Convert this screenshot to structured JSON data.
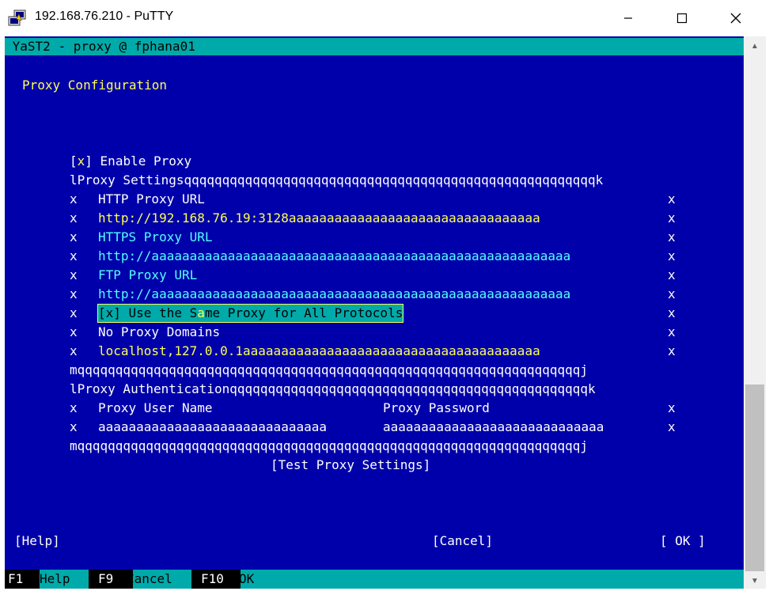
{
  "window": {
    "title": "192.168.76.210 - PuTTY",
    "icon": "putty-icon",
    "controls": [
      "minimize-icon",
      "maximize-icon",
      "close-icon"
    ]
  },
  "terminal": {
    "header": "YaST2 - proxy @ fphana01",
    "page_title": "Proxy Configuration",
    "enable_proxy": {
      "box": "[x]",
      "label": "Enable Proxy"
    },
    "frame_settings_top": "lProxy Settingsqqqqqqqqqqqqqqqqqqqqqqqqqqqqqqqqqqqqqqqqqqqqqqqqqqqqqqk",
    "http_label": "HTTP Proxy URL",
    "http_value": "http://192.168.76.19:3128aaaaaaaaaaaaaaaaaaaaaaaaaaaaaaaaa",
    "https_label": "HTTPS Proxy URL",
    "https_value": "http://aaaaaaaaaaaaaaaaaaaaaaaaaaaaaaaaaaaaaaaaaaaaaaaaaaaaaaa",
    "ftp_label": "FTP Proxy URL",
    "ftp_value": "http://aaaaaaaaaaaaaaaaaaaaaaaaaaaaaaaaaaaaaaaaaaaaaaaaaaaaaaa",
    "same_proxy": {
      "pre": "[x] Use the S",
      "cursor": "a",
      "post": "me Proxy for All Protocols"
    },
    "no_proxy_label": "No Proxy Domains",
    "no_proxy_value": "localhost,127.0.0.1aaaaaaaaaaaaaaaaaaaaaaaaaaaaaaaaaaaaaaa",
    "frame_settings_bottom": "mqqqqqqqqqqqqqqqqqqqqqqqqqqqqqqqqqqqqqqqqqqqqqqqqqqqqqqqqqqqqqqqqqqj",
    "frame_auth_top": "lProxy Authenticationqqqqqqqqqqqqqqqqqqqqqqqqqqqqqqqqqqqqqqqqqqqqqqqk",
    "user_label": "Proxy User Name",
    "password_label": "Proxy Password",
    "user_value": "aaaaaaaaaaaaaaaaaaaaaaaaaaaaaa",
    "password_value": "aaaaaaaaaaaaaaaaaaaaaaaaaaaaa",
    "frame_auth_bottom": "mqqqqqqqqqqqqqqqqqqqqqqqqqqqqqqqqqqqqqqqqqqqqqqqqqqqqqqqqqqqqqqqqqqj",
    "frame_side": "x",
    "test_button": "[Test Proxy Settings]",
    "help_button": "[Help]",
    "cancel_button": "[Cancel]",
    "ok_button": "[ OK ]",
    "fkeys": [
      {
        "key": "F1",
        "label": "Help"
      },
      {
        "key": "F9",
        "label": "Cancel"
      },
      {
        "key": "F10",
        "label": "OK"
      }
    ]
  },
  "colors": {
    "terminal_bg": "#0000aa",
    "accent_cyan": "#00aaaa",
    "text_yellow": "#ffff55",
    "text_cyan": "#55ffff"
  }
}
